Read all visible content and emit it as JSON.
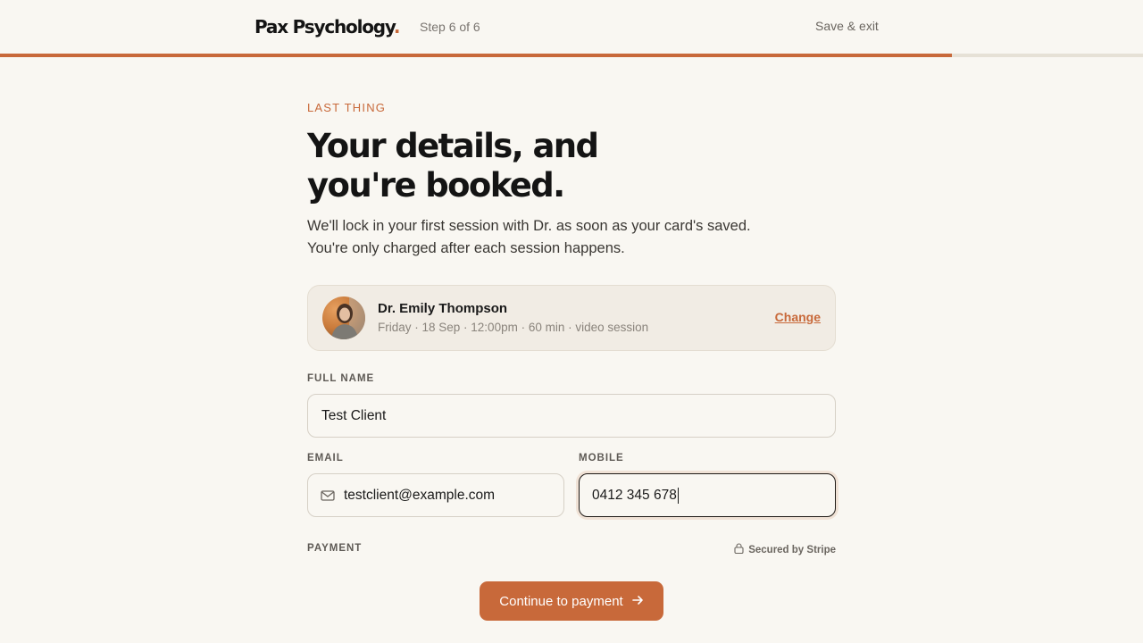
{
  "header": {
    "logo_text": "Pax Psychology",
    "logo_dot": ".",
    "step_text": "Step 6 of 6",
    "save_exit_label": "Save & exit",
    "progress": 0.833
  },
  "main": {
    "eyebrow": "LAST THING",
    "headline_line1": "Your details, and",
    "headline_line2": "you're booked.",
    "subtext_line1": "We'll lock in your first session with Dr. as soon as your card's saved.",
    "subtext_line2": "You're only charged after each session happens."
  },
  "therapist": {
    "name": "Dr. Emily Thompson",
    "details": "Friday · 18 Sep · 12:00pm · 60 min · video session",
    "change_label": "Change"
  },
  "form": {
    "full_name_label": "FULL NAME",
    "full_name_value": "Test Client",
    "email_label": "EMAIL",
    "email_value": "testclient@example.com",
    "mobile_label": "MOBILE",
    "mobile_value": "0412 345 678",
    "payment_label": "PAYMENT",
    "secured_text": "Secured by Stripe"
  },
  "cta": {
    "label": "Continue to payment"
  },
  "colors": {
    "accent": "#c8693a",
    "background": "#f9f7f2",
    "card": "#f1ece4"
  },
  "icons": [
    "mail-icon",
    "lock-icon",
    "arrow-right-icon"
  ]
}
